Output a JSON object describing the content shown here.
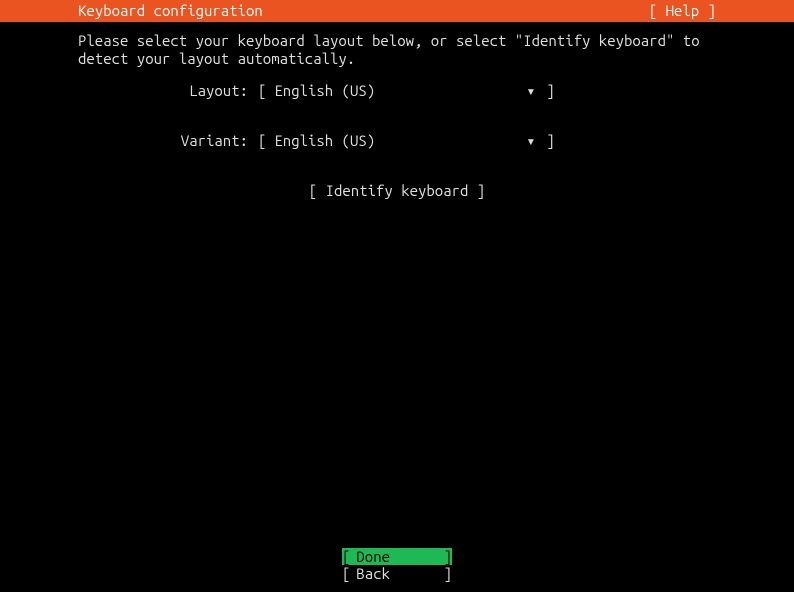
{
  "header": {
    "title": "Keyboard configuration",
    "help": "[ Help ]"
  },
  "instruction": "Please select your keyboard layout below, or select \"Identify keyboard\" to\ndetect your layout automatically.",
  "fields": {
    "layout": {
      "label": "Layout:",
      "value": "English (US)",
      "arrow": "▾"
    },
    "variant": {
      "label": "Variant:",
      "value": "English (US)",
      "arrow": "▾"
    }
  },
  "identify": {
    "label": "[ Identify keyboard ]"
  },
  "footer": {
    "done": "Done",
    "back": "Back"
  }
}
